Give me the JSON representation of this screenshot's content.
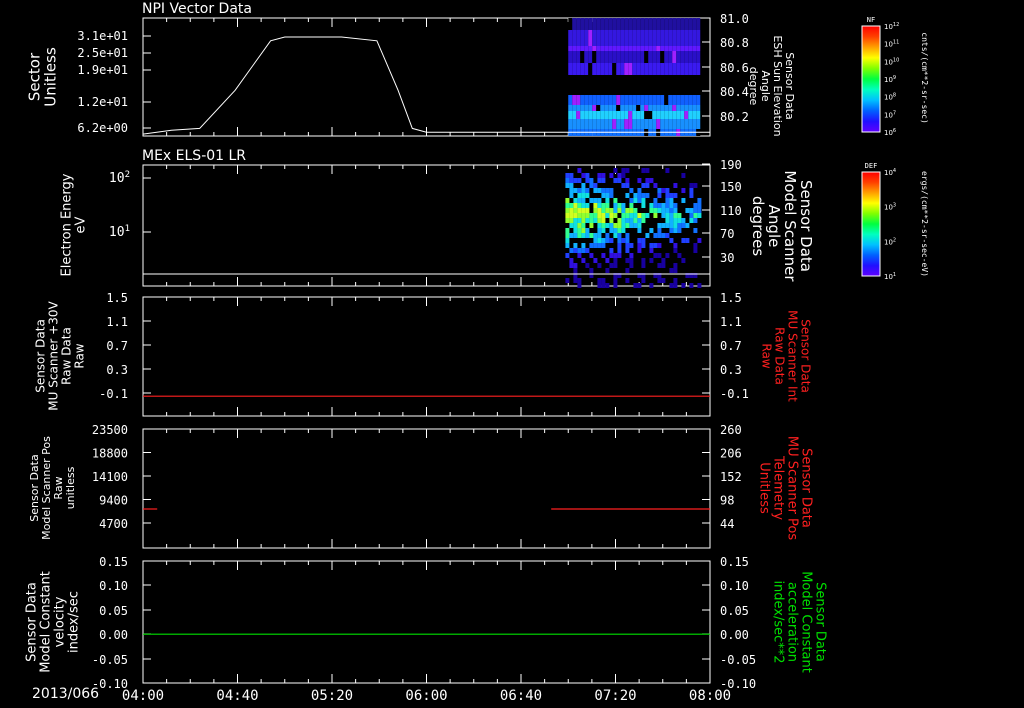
{
  "colors": {
    "white": "#ffffff",
    "red": "#ff2020",
    "green": "#00e000"
  },
  "chart_data": [
    {
      "type": "line+heatmap",
      "title": "NPI Vector Data",
      "left_axis": {
        "label": [
          "Sector",
          "Unitless"
        ],
        "ticks": [
          "3.1e+01",
          "2.5e+01",
          "1.9e+01",
          "1.2e+01",
          "6.2e+00"
        ],
        "ylim": [
          0,
          31
        ]
      },
      "right_axis": {
        "label": [
          "Sensor Data",
          "ESH Sun Elevation",
          "Angle",
          "degree"
        ],
        "ticks": [
          "81.0",
          "80.8",
          "80.6",
          "80.4",
          "80.2"
        ],
        "ylim": [
          80.0,
          81.0
        ]
      },
      "x_hours": [
        4.0,
        4.2,
        4.4,
        4.65,
        4.9,
        5.0,
        5.2,
        5.4,
        5.65,
        5.8,
        5.9,
        6.0,
        8.0
      ],
      "y": [
        0.5,
        1.5,
        2,
        12,
        25,
        26,
        26,
        26,
        25,
        12,
        2,
        1,
        1
      ],
      "heatmap_start_hour": 7.0,
      "colorbar": {
        "name": "NF",
        "units": "cnts/(cm**2-sr-sec)",
        "ticks": [
          "10^12",
          "10^11",
          "10^10",
          "10^9",
          "10^8",
          "10^7",
          "10^6"
        ]
      }
    },
    {
      "type": "heatmap",
      "title": "MEx ELS-01 LR",
      "left_axis": {
        "label": [
          "Electron Energy",
          "eV"
        ],
        "ticks": [
          "10^2",
          "10^1"
        ],
        "scale": "log"
      },
      "right_axis": {
        "label": [
          "Sensor Data",
          "Model Scanner",
          "Angle",
          "degrees"
        ],
        "ticks": [
          "190",
          "150",
          "110",
          "70",
          "30"
        ],
        "ylim": [
          0,
          190
        ]
      },
      "heatmap_start_hour": 6.98,
      "colorbar": {
        "name": "DEF",
        "units": "ergs/(cm**2-sr-sec-eV)",
        "ticks": [
          "10^4",
          "10^3",
          "10^2",
          "10^1"
        ]
      }
    },
    {
      "type": "line",
      "title": "",
      "left_axis": {
        "label": [
          "Sensor Data",
          "MU Scanner +30V",
          "Raw Data",
          "Raw"
        ],
        "ticks": [
          "1.5",
          "1.1",
          "0.7",
          "0.3",
          "-0.1"
        ],
        "ylim": [
          -0.3,
          1.5
        ]
      },
      "right_axis": {
        "label": [
          "Sensor Data",
          "MU Scanner Int",
          "Raw Data",
          "Raw"
        ],
        "ticks": [
          "1.5",
          "1.1",
          "0.7",
          "0.3",
          "-0.1"
        ],
        "ylim": [
          -0.3,
          1.5
        ]
      },
      "series": [
        {
          "x_hours": [
            4.0,
            8.0
          ],
          "y": [
            0,
            0
          ],
          "color": "#ff2020"
        }
      ]
    },
    {
      "type": "line",
      "title": "",
      "left_axis": {
        "label": [
          "Sensor Data",
          "Model Scanner Pos",
          "Raw",
          "unitless"
        ],
        "ticks": [
          "23500",
          "18800",
          "14100",
          "9400",
          "4700"
        ],
        "ylim": [
          0,
          23500
        ]
      },
      "right_axis": {
        "label": [
          "Sensor Data",
          "MU Scanner Pos",
          "Telemetry",
          "Unitless"
        ],
        "ticks": [
          "260",
          "206",
          "152",
          "98",
          "44"
        ],
        "ylim": [
          0,
          260
        ]
      },
      "series": [
        {
          "x_hours": [
            4.0,
            4.1
          ],
          "y": [
            7700,
            7700
          ],
          "color": "#ff2020"
        },
        {
          "x_hours": [
            6.88,
            8.0
          ],
          "y": [
            7700,
            7700
          ],
          "color": "#ff2020"
        }
      ]
    },
    {
      "type": "line",
      "title": "",
      "left_axis": {
        "label": [
          "Sensor Data",
          "Model Constant",
          "velocity",
          "index/sec"
        ],
        "ticks": [
          "0.15",
          "0.10",
          "0.05",
          "0.00",
          "-0.05",
          "-0.10"
        ],
        "ylim": [
          -0.1,
          0.15
        ]
      },
      "right_axis": {
        "label": [
          "Sensor Data",
          "Model Constant",
          "acceleration",
          "index/sec**2"
        ],
        "ticks": [
          "0.15",
          "0.10",
          "0.05",
          "0.00",
          "-0.05",
          "-0.10"
        ],
        "ylim": [
          -0.1,
          0.15
        ]
      },
      "series": [
        {
          "x_hours": [
            4.0,
            8.0
          ],
          "y": [
            0,
            0
          ],
          "color": "#00e000"
        }
      ]
    }
  ],
  "x_axis": {
    "date": "2013/066",
    "ticks": [
      "04:00",
      "04:40",
      "05:20",
      "06:00",
      "06:40",
      "07:20",
      "08:00"
    ],
    "xlim_hours": [
      4.0,
      8.0
    ]
  }
}
